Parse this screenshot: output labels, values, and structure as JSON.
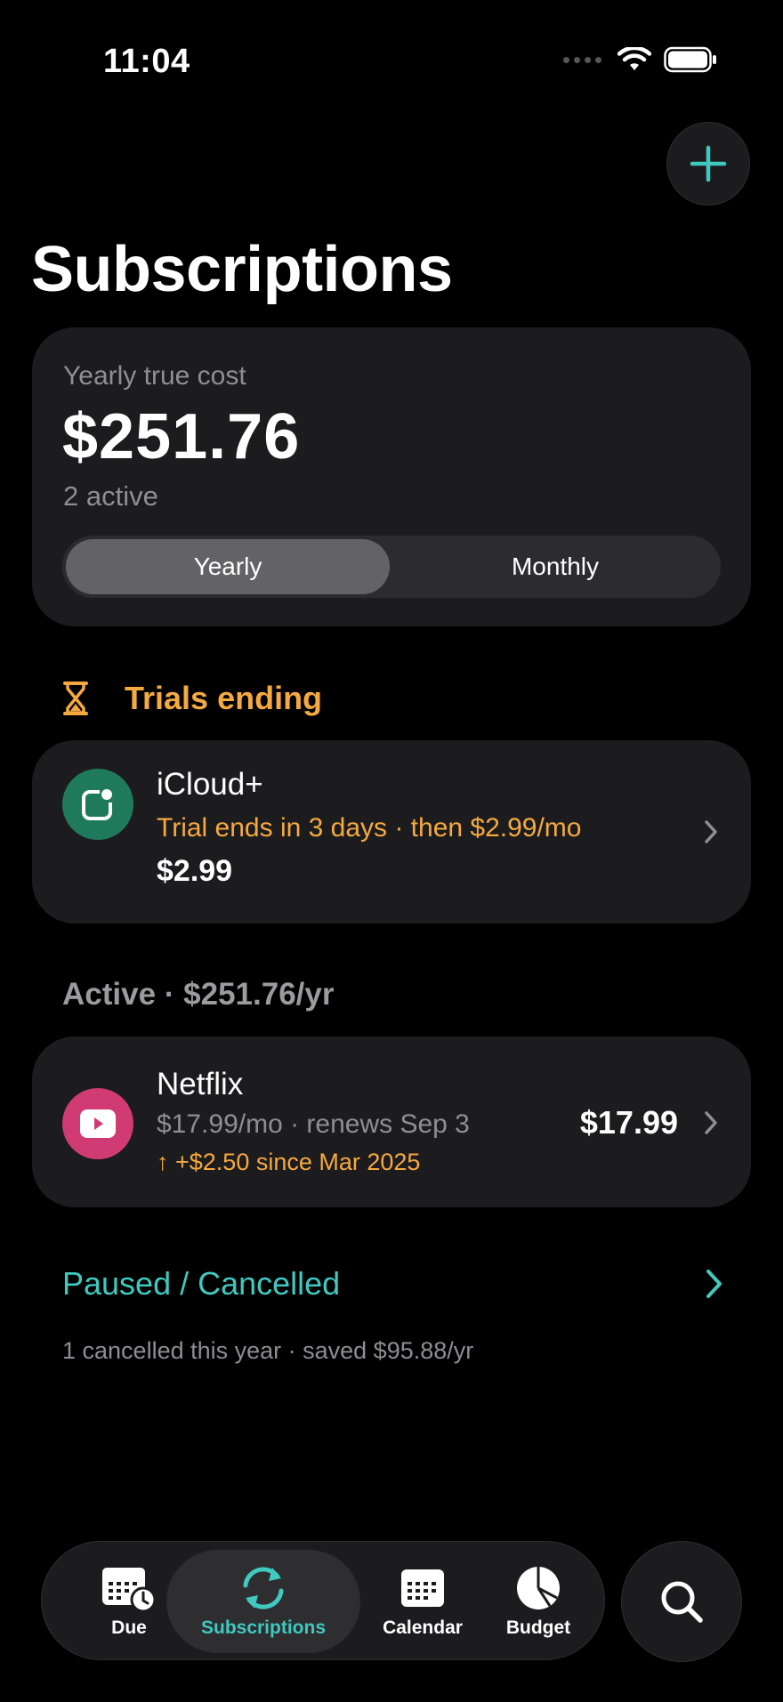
{
  "status_bar": {
    "time": "11:04"
  },
  "header": {
    "title": "Subscriptions",
    "add_icon": "plus-icon"
  },
  "summary": {
    "label": "Yearly true cost",
    "amount": "$251.76",
    "active_count": "2 active",
    "segments": [
      "Yearly",
      "Monthly"
    ],
    "selected_segment": "Yearly"
  },
  "trials": {
    "heading": "Trials ending",
    "icon": "hourglass-icon",
    "items": [
      {
        "name": "iCloud+",
        "subtitle": "Trial ends in 3 days · then $2.99/mo",
        "price": "$2.99"
      }
    ]
  },
  "active": {
    "heading": "Active · $251.76/yr",
    "items": [
      {
        "name": "Netflix",
        "subtitle": "$17.99/mo · renews Sep 3",
        "change": "↑ +$2.50 since Mar 2025",
        "price": "$17.99"
      }
    ]
  },
  "paused": {
    "label": "Paused / Cancelled",
    "note": "1 cancelled this year · saved $95.88/yr"
  },
  "tab_bar": {
    "tabs": [
      {
        "label": "Due",
        "icon": "calendar-clock-icon"
      },
      {
        "label": "Subscriptions",
        "icon": "refresh-icon"
      },
      {
        "label": "Calendar",
        "icon": "calendar-icon"
      },
      {
        "label": "Budget",
        "icon": "pie-chart-icon"
      }
    ],
    "selected": "Subscriptions",
    "search_icon": "search-icon"
  },
  "colors": {
    "accent": "#3fc9bf",
    "warning": "#f5a93f",
    "card": "#1c1c1e",
    "background": "#000000",
    "icloud": "#1f7a5c",
    "netflix": "#d13b73"
  }
}
